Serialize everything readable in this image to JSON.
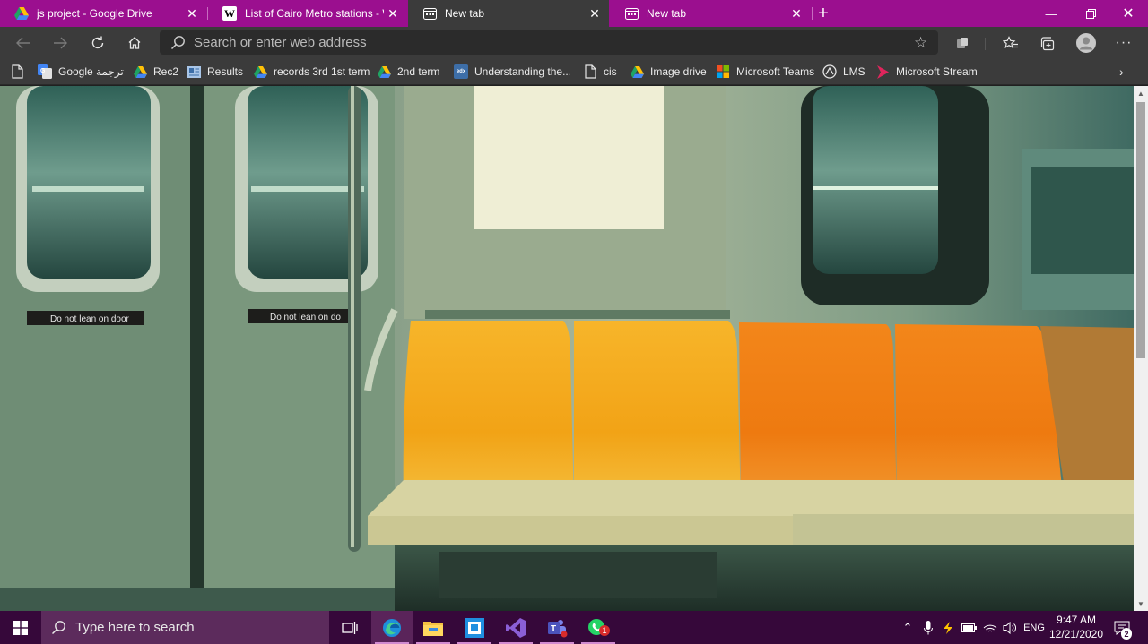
{
  "browser": {
    "tabs": [
      {
        "title": "js project - Google Drive",
        "icon": "google-drive-icon",
        "active": false
      },
      {
        "title": "List of Cairo Metro stations - Wi",
        "icon": "wikipedia-icon",
        "active": false
      },
      {
        "title": "New tab",
        "icon": "newtab-page-icon",
        "active": true
      },
      {
        "title": "New tab",
        "icon": "newtab-page-icon",
        "active": false
      }
    ],
    "address_placeholder": "Search or enter web address",
    "bookmarks": [
      {
        "label": "",
        "icon": "page-icon"
      },
      {
        "label": "Google ترجمة",
        "icon": "google-translate-icon"
      },
      {
        "label": "Rec2",
        "icon": "google-drive-icon"
      },
      {
        "label": "Results",
        "icon": "document-icon"
      },
      {
        "label": "records 3rd 1st term",
        "icon": "google-drive-icon"
      },
      {
        "label": "2nd term",
        "icon": "google-drive-icon"
      },
      {
        "label": "Understanding the...",
        "icon": "edx-icon"
      },
      {
        "label": "cis",
        "icon": "page-icon"
      },
      {
        "label": "Image drive",
        "icon": "google-drive-icon"
      },
      {
        "label": "Microsoft Teams",
        "icon": "microsoft-icon"
      },
      {
        "label": "LMS",
        "icon": "lms-icon"
      },
      {
        "label": "Microsoft Stream",
        "icon": "stream-icon"
      }
    ]
  },
  "background_image": {
    "signs": [
      "Do not lean on door",
      "Do not lean on do"
    ]
  },
  "taskbar": {
    "search_placeholder": "Type here to search",
    "language": "ENG",
    "time": "9:47 AM",
    "date": "12/21/2020",
    "notification_count": "2",
    "whatsapp_badge": "1"
  },
  "colors": {
    "tab_strip": "#9b0f8f",
    "toolbar": "#3b3b3b",
    "taskbar": "#36083a",
    "seat_yellow": "#f5a315",
    "seat_orange": "#f07a10"
  }
}
